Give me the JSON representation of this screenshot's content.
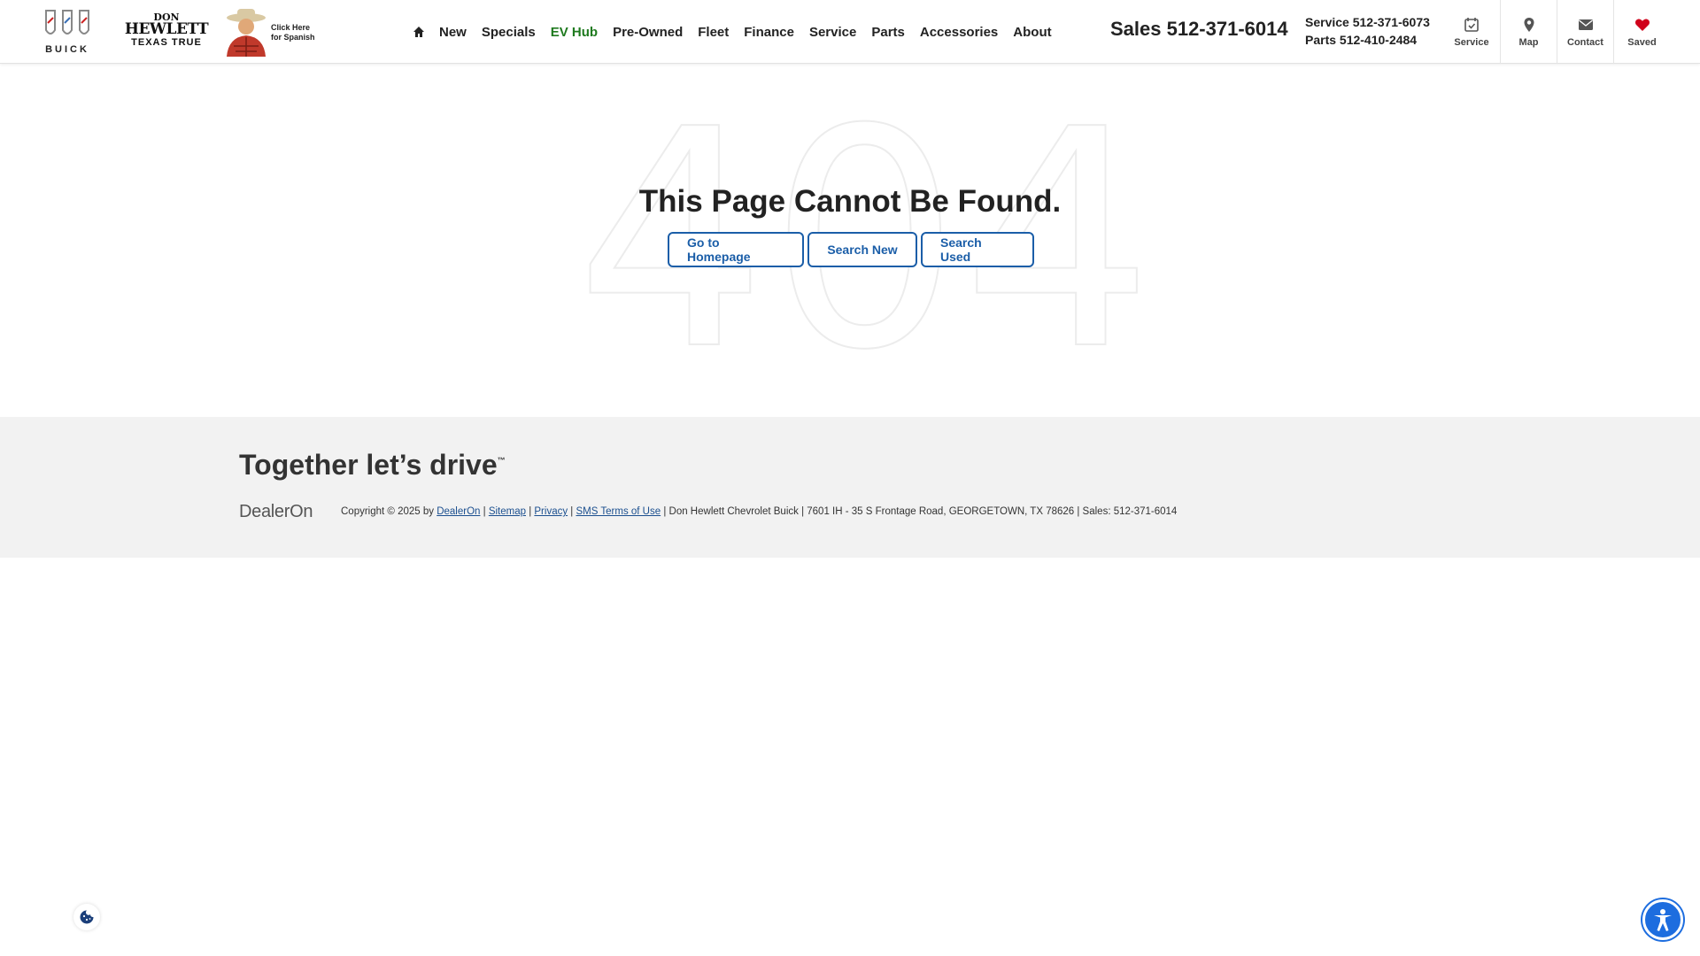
{
  "header": {
    "brand": {
      "buick_word": "BUICK"
    },
    "dealer_logo": {
      "line1": "DON",
      "line2": "HEWLETT",
      "line3": "TEXAS TRUE"
    },
    "spanish_promo": {
      "line1": "Click Here",
      "line2": "for Spanish"
    },
    "nav": {
      "home_icon": "home-icon",
      "items": [
        {
          "label": "New"
        },
        {
          "label": "Specials"
        },
        {
          "label": "EV Hub",
          "color": "#1f7a1f"
        },
        {
          "label": "Pre-Owned"
        },
        {
          "label": "Fleet"
        },
        {
          "label": "Finance"
        },
        {
          "label": "Service"
        },
        {
          "label": "Parts"
        },
        {
          "label": "Accessories"
        },
        {
          "label": "About"
        }
      ]
    },
    "sales_phone": "Sales 512-371-6014",
    "service_phone": "Service 512-371-6073",
    "parts_phone": "Parts 512-410-2484",
    "tools": [
      {
        "label": "Service",
        "icon": "calendar-check-icon"
      },
      {
        "label": "Map",
        "icon": "map-pin-icon"
      },
      {
        "label": "Contact",
        "icon": "envelope-icon"
      },
      {
        "label": "Saved",
        "icon": "heart-icon"
      }
    ]
  },
  "main": {
    "background_number": "404",
    "title": "This Page Cannot Be Found.",
    "buttons": {
      "home": "Go to Homepage",
      "new": "Search New",
      "used": "Search Used"
    }
  },
  "footer": {
    "tagline": "Together let’s drive",
    "tagline_mark": "™",
    "dealeron_logo": "DealerOn",
    "copyright_prefix": "Copyright © 2025 by ",
    "links": {
      "dealeron": "DealerOn",
      "sitemap": "Sitemap",
      "privacy": "Privacy",
      "sms_terms": "SMS Terms of Use"
    },
    "address_text": " | Don Hewlett Chevrolet Buick | 7601 IH - 35 S Frontage Road, GEORGETOWN, TX 78626 | Sales: 512-371-6014"
  },
  "colors": {
    "accent": "#1b5ea8",
    "ev_green": "#1f7a1f",
    "saved_heart": "#d0021b",
    "a11y_blue": "#1d6ddf"
  }
}
